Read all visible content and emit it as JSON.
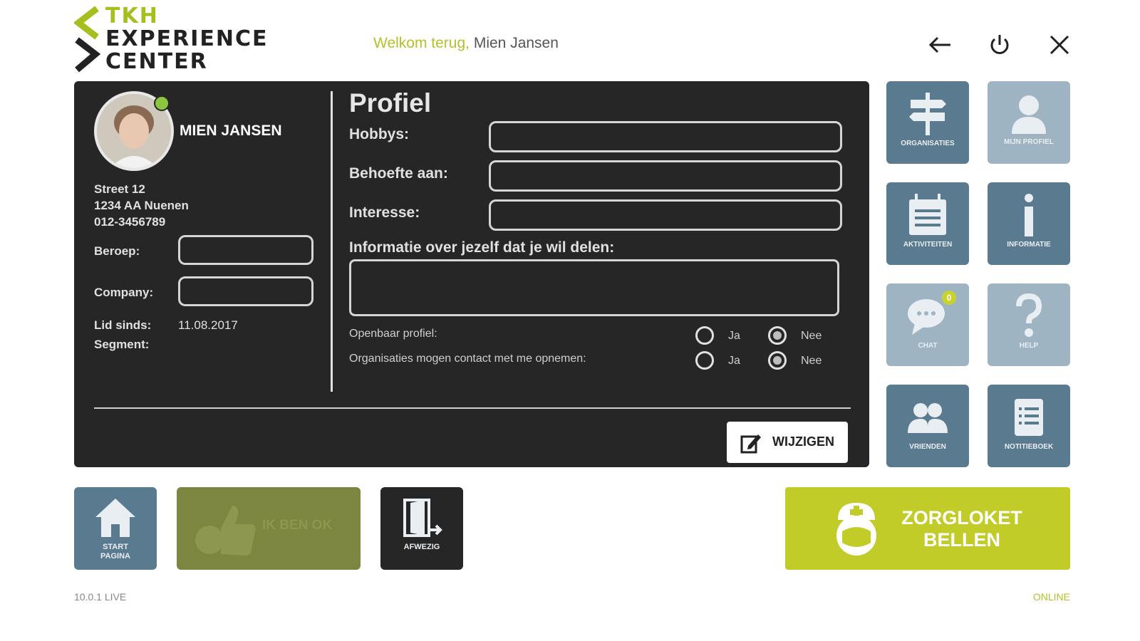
{
  "header": {
    "logo": {
      "line1": "TKH",
      "line2": "EXPERIENCE",
      "line3": "CENTER"
    },
    "welcome_prefix": "Welkom terug,",
    "welcome_name": "Mien Jansen",
    "icons": [
      "back-arrow-icon",
      "power-icon",
      "close-icon"
    ]
  },
  "profile_card": {
    "name": "MIEN JANSEN",
    "address_line1": "Street 12",
    "address_line2": "1234 AA Nuenen",
    "phone": "012-3456789",
    "occupation_label": "Beroep:",
    "occupation_value": "",
    "company_label": "Company:",
    "company_value": "",
    "member_since_label": "Lid sinds:",
    "member_since_value": "11.08.2017",
    "segment_label": "Segment:",
    "segment_value": ""
  },
  "profile_form": {
    "title": "Profiel",
    "hobbies_label": "Hobbys:",
    "hobbies_value": "",
    "needs_label": "Behoefte aan:",
    "needs_value": "",
    "interest_label": "Interesse:",
    "interest_value": "",
    "about_label": "Informatie over jezelf dat je wil delen:",
    "about_value": "",
    "public_profile_label": "Openbaar profiel:",
    "contact_label": "Organisaties mogen contact met me opnemen:",
    "yes_label": "Ja",
    "no_label": "Nee",
    "public_profile_selected": "Nee",
    "contact_selected": "Nee",
    "edit_label": "WIJZIGEN"
  },
  "tiles": [
    {
      "label": "ORGANISATIES",
      "icon": "signpost-icon"
    },
    {
      "label": "MIJN PROFIEL",
      "icon": "person-icon"
    },
    {
      "label": "AKTIVITEITEN",
      "icon": "calendar-icon"
    },
    {
      "label": "INFORMATIE",
      "icon": "info-icon"
    },
    {
      "label": "CHAT",
      "icon": "chat-icon",
      "badge": "0"
    },
    {
      "label": "HELP",
      "icon": "question-icon"
    },
    {
      "label": "VRIENDEN",
      "icon": "friends-icon"
    },
    {
      "label": "NOTITIEBOEK",
      "icon": "notebook-icon"
    }
  ],
  "bottom": {
    "home_label_1": "START",
    "home_label_2": "PAGINA",
    "ok_label": "IK BEN OK",
    "away_label": "AFWEZIG",
    "call_label_1": "ZORGLOKET",
    "call_label_2": "BELLEN"
  },
  "footer": {
    "version": "10.0.1 LIVE",
    "status": "ONLINE"
  },
  "colors": {
    "accent": "#b4c22a",
    "panel": "#262626",
    "tile_dark": "#5a7a8f",
    "tile_light": "#9fb4c2",
    "call_button": "#c2cc28"
  }
}
